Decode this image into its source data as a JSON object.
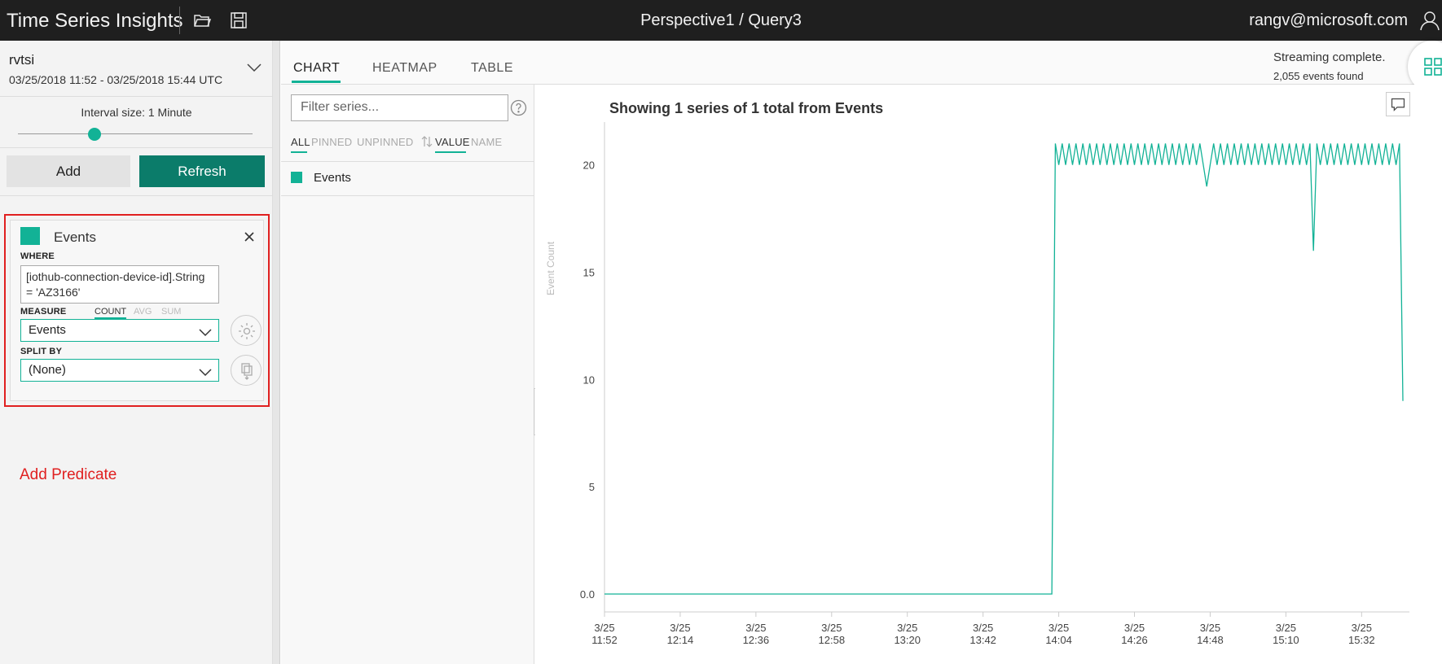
{
  "app": {
    "title": "Time Series Insights",
    "breadcrumb": "Perspective1 / Query3",
    "user": "rangv@microsoft.com"
  },
  "environment": {
    "name": "rvtsi",
    "range": "03/25/2018 11:52  -  03/25/2018 15:44 UTC"
  },
  "interval": {
    "label": "Interval size: 1 Minute"
  },
  "actions": {
    "add_label": "Add",
    "refresh_label": "Refresh"
  },
  "query": {
    "title": "Events",
    "where_label": "WHERE",
    "where_value": "[iothub-connection-device-id].String = 'AZ3166'",
    "measure_label": "MEASURE",
    "aggregations": [
      "COUNT",
      "AVG",
      "SUM"
    ],
    "measure_value": "Events",
    "split_label": "SPLIT BY",
    "split_value": "(None)",
    "add_predicate": "Add Predicate"
  },
  "tabs": [
    "CHART",
    "HEATMAP",
    "TABLE"
  ],
  "status": {
    "line1": "Streaming complete.",
    "line2": "2,055 events found"
  },
  "series_panel": {
    "filter_placeholder": "Filter series...",
    "filters": [
      "ALL",
      "PINNED",
      "UNPINNED"
    ],
    "sorts": [
      "VALUE",
      "NAME"
    ],
    "items": [
      "Events"
    ]
  },
  "colors": {
    "accent": "#12b296",
    "refresh": "#0b7c6a",
    "highlight": "#e02020",
    "topbar": "#1f1f1f"
  },
  "chart_data": {
    "type": "line",
    "title": "Showing 1 series of 1 total from Events",
    "ylabel": "Event Count",
    "xlabel": "",
    "x_ticks": [
      "3/25\n11:52",
      "3/25\n12:14",
      "3/25\n12:36",
      "3/25\n12:58",
      "3/25\n13:20",
      "3/25\n13:42",
      "3/25\n14:04",
      "3/25\n14:26",
      "3/25\n14:48",
      "3/25\n15:10",
      "3/25\n15:32"
    ],
    "y_ticks": [
      "0.0",
      "5",
      "10",
      "15",
      "20"
    ],
    "ylim": [
      0,
      22
    ],
    "x_range": [
      "11:52",
      "15:44"
    ],
    "series": [
      {
        "name": "Events",
        "color": "#12b296",
        "description": "0 from 11:52 until about 14:02, then oscillating between 20 and 21 events per minute through 15:43, with dips to ~19 near 14:47 and ~16 near 15:18, ending near 9 at 15:44",
        "segments": [
          {
            "from": "11:52",
            "to": "14:02",
            "value": 0
          },
          {
            "from": "14:03",
            "to": "15:43",
            "min": 20,
            "max": 21
          },
          {
            "at": "14:47",
            "value": 19
          },
          {
            "at": "15:18",
            "value": 16
          },
          {
            "at": "15:44",
            "value": 9
          }
        ]
      }
    ]
  }
}
